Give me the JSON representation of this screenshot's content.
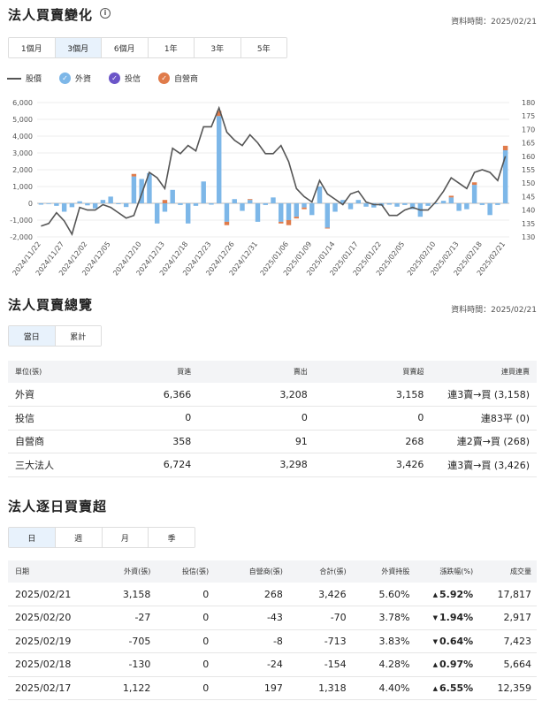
{
  "section1": {
    "title": "法人買賣變化",
    "data_time": "資料時間：2025/02/21",
    "range_tabs": [
      "1個月",
      "3個月",
      "6個月",
      "1年",
      "3年",
      "5年"
    ],
    "active_range": 1,
    "legend": {
      "price": "股價",
      "foreign": "外資",
      "trust": "投信",
      "dealer": "自營商"
    },
    "colors": {
      "price": "#555555",
      "foreign": "#7db7e8",
      "trust": "#6b55c8",
      "dealer": "#e07b4a"
    }
  },
  "chart_data": {
    "type": "bar",
    "series": [
      {
        "name": "外資",
        "values": [
          -80,
          -40,
          -150,
          -500,
          -230,
          120,
          -120,
          -300,
          200,
          400,
          -50,
          -220,
          1600,
          1450,
          1800,
          -1200,
          -500,
          800,
          -100,
          -1200,
          -150,
          1300,
          -80,
          5200,
          -1100,
          250,
          -450,
          200,
          -1100,
          -100,
          350,
          -1100,
          -1000,
          -800,
          -250,
          -700,
          1000,
          -1450,
          -500,
          200,
          -350,
          200,
          -200,
          -250,
          -150,
          -80,
          -200,
          -100,
          -350,
          -800,
          -150,
          -50,
          150,
          350,
          -450,
          -350,
          1100,
          -100,
          -700,
          -100,
          3158
        ]
      },
      {
        "name": "投信",
        "values": [
          0,
          0,
          0,
          0,
          0,
          0,
          0,
          0,
          0,
          0,
          0,
          0,
          0,
          0,
          0,
          0,
          0,
          0,
          0,
          0,
          0,
          0,
          0,
          0,
          0,
          0,
          0,
          0,
          0,
          0,
          0,
          0,
          0,
          0,
          0,
          0,
          0,
          0,
          0,
          0,
          0,
          0,
          0,
          0,
          0,
          0,
          0,
          0,
          0,
          0,
          0,
          0,
          0,
          0,
          0,
          0,
          0,
          0,
          0,
          0,
          0
        ]
      },
      {
        "name": "自營商",
        "values": [
          0,
          0,
          0,
          0,
          0,
          0,
          0,
          0,
          0,
          0,
          0,
          0,
          150,
          0,
          0,
          0,
          200,
          0,
          0,
          0,
          0,
          0,
          0,
          300,
          -200,
          0,
          0,
          50,
          0,
          0,
          0,
          -100,
          -300,
          -100,
          -100,
          0,
          0,
          -50,
          0,
          0,
          0,
          0,
          0,
          0,
          0,
          0,
          0,
          0,
          0,
          0,
          0,
          0,
          0,
          100,
          0,
          0,
          150,
          0,
          0,
          0,
          268
        ]
      },
      {
        "name": "股價",
        "values": [
          134,
          135,
          139,
          136,
          131,
          141,
          140,
          140,
          142,
          141,
          139,
          137,
          138,
          146,
          154,
          152,
          148,
          163,
          161,
          164,
          162,
          171,
          171,
          178,
          169,
          166,
          164,
          168,
          165,
          161,
          161,
          164,
          158,
          148,
          145,
          143,
          151,
          146,
          144,
          142,
          146,
          147,
          143,
          142,
          142,
          138,
          138,
          140,
          141,
          140,
          140,
          143,
          147,
          152,
          150,
          148,
          154,
          155,
          154,
          151,
          160
        ]
      }
    ],
    "x_ticks": [
      "2024/11/22",
      "2024/11/27",
      "2024/12/02",
      "2024/12/05",
      "2024/12/10",
      "2024/12/13",
      "2024/12/18",
      "2024/12/23",
      "2024/12/26",
      "2024/12/31",
      "2025/01/06",
      "2025/01/09",
      "2025/01/14",
      "2025/01/17",
      "2025/01/22",
      "2025/02/05",
      "2025/02/10",
      "2025/02/13",
      "2025/02/18",
      "2025/02/21"
    ],
    "y_left_ticks": [
      "6,000",
      "5,000",
      "4,000",
      "3,000",
      "2,000",
      "1,000",
      "0",
      "-1,000",
      "-2,000"
    ],
    "y_right_ticks": [
      "180",
      "175",
      "170",
      "165",
      "160",
      "155",
      "150",
      "145",
      "140",
      "135",
      "130"
    ],
    "y_left_lim": [
      -2000,
      6000
    ],
    "y_right_lim": [
      130,
      180
    ],
    "grid": true
  },
  "section2": {
    "title": "法人買賣總覽",
    "data_time": "資料時間：2025/02/21",
    "tabs": [
      "當日",
      "累計"
    ],
    "headers": [
      "單位(張)",
      "買進",
      "賣出",
      "買賣超",
      "連買連賣"
    ],
    "rows": [
      {
        "name": "外資",
        "buy": "6,366",
        "sell": "3,208",
        "net": "3,158",
        "streak": "連3賣→買 (3,158)",
        "streak_color": "red"
      },
      {
        "name": "投信",
        "buy": "0",
        "sell": "0",
        "net": "0",
        "streak": "連83平 (0)",
        "streak_color": "black"
      },
      {
        "name": "自營商",
        "buy": "358",
        "sell": "91",
        "net": "268",
        "streak": "連2賣→買 (268)",
        "streak_color": "red"
      },
      {
        "name": "三大法人",
        "buy": "6,724",
        "sell": "3,298",
        "net": "3,426",
        "streak": "連3賣→買 (3,426)",
        "streak_color": "red"
      }
    ]
  },
  "section3": {
    "title": "法人逐日買賣超",
    "tabs": [
      "日",
      "週",
      "月",
      "季"
    ],
    "headers": [
      "日期",
      "外資(張)",
      "投信(張)",
      "自營商(張)",
      "合計(張)",
      "外資持股",
      "漲跌幅(%)",
      "成交量"
    ],
    "rows": [
      {
        "date": "2025/02/21",
        "foreign": "3,158",
        "trust": "0",
        "dealer": "268",
        "total": "3,426",
        "total_color": "red",
        "hold": "5.60%",
        "chg": "5.92%",
        "chg_dir": "up",
        "vol": "17,817"
      },
      {
        "date": "2025/02/20",
        "foreign": "-27",
        "trust": "0",
        "dealer": "-43",
        "total": "-70",
        "total_color": "green",
        "hold": "3.78%",
        "chg": "1.94%",
        "chg_dir": "down",
        "vol": "2,917"
      },
      {
        "date": "2025/02/19",
        "foreign": "-705",
        "trust": "0",
        "dealer": "-8",
        "total": "-713",
        "total_color": "green",
        "hold": "3.83%",
        "chg": "0.64%",
        "chg_dir": "down",
        "vol": "7,423"
      },
      {
        "date": "2025/02/18",
        "foreign": "-130",
        "trust": "0",
        "dealer": "-24",
        "total": "-154",
        "total_color": "green",
        "hold": "4.28%",
        "chg": "0.97%",
        "chg_dir": "up",
        "vol": "5,664"
      },
      {
        "date": "2025/02/17",
        "foreign": "1,122",
        "trust": "0",
        "dealer": "197",
        "total": "1,318",
        "total_color": "red",
        "hold": "4.40%",
        "chg": "6.55%",
        "chg_dir": "up",
        "vol": "12,359"
      }
    ]
  }
}
